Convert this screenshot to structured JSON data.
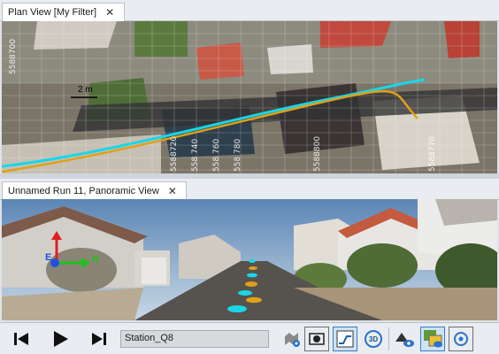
{
  "plan": {
    "tab_title": "Plan View [My Filter]",
    "scale_label": "2 m",
    "grid_labels": [
      "5588700",
      "5588720",
      "558 740",
      "558 760",
      "558 780",
      "5588800",
      "5588770"
    ]
  },
  "pano": {
    "tab_title": "Unnamed Run  11, Panoramic View",
    "axis_labels": {
      "e": "E",
      "n": "N"
    }
  },
  "toolbar": {
    "station_value": "Station_Q8",
    "buttons": [
      "skip-back",
      "play",
      "skip-forward",
      "map-overlay",
      "snapshot",
      "profile",
      "3d-view",
      "cloud-visibility",
      "image-overlay",
      "settings"
    ],
    "view_3d_label": "3D"
  },
  "colors": {
    "trajectory_cyan": "#19d6e8",
    "trajectory_orange": "#e0a019",
    "accent": "#3a7cc0"
  }
}
